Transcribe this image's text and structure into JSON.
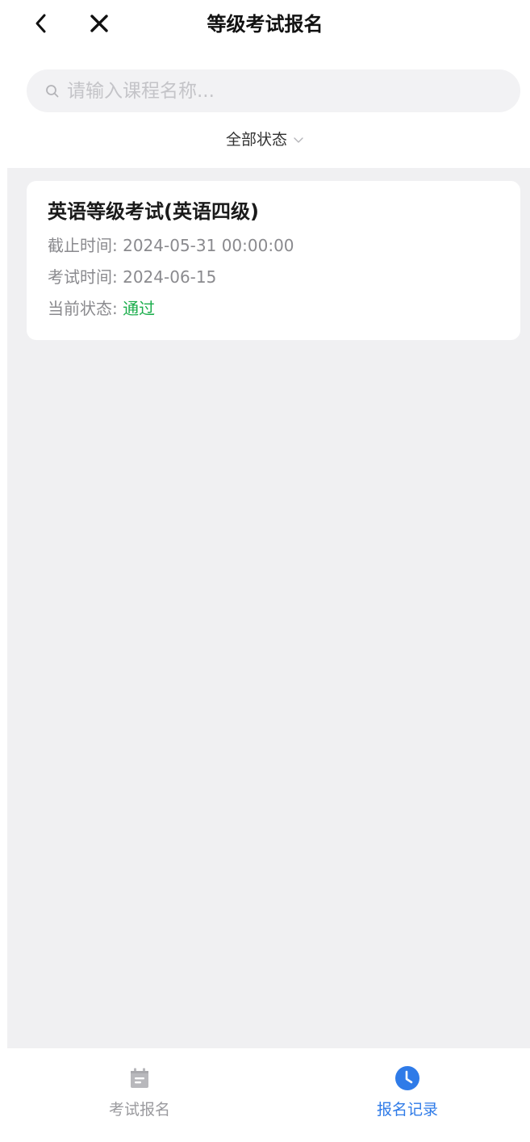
{
  "header": {
    "title": "等级考试报名",
    "back_icon": "chevron-left-icon",
    "close_icon": "close-icon"
  },
  "search": {
    "placeholder": "请输入课程名称...",
    "value": "",
    "icon": "search-icon"
  },
  "filter": {
    "label": "全部状态",
    "icon": "chevron-down-icon"
  },
  "records": [
    {
      "title": "英语等级考试(英语四级)",
      "deadline_label": "截止时间:",
      "deadline_value": "2024-05-31 00:00:00",
      "exam_time_label": "考试时间:",
      "exam_time_value": "2024-06-15",
      "status_label": "当前状态:",
      "status_value": "通过"
    }
  ],
  "tabbar": {
    "items": [
      {
        "label": "考试报名",
        "icon": "calendar-icon",
        "active": false
      },
      {
        "label": "报名记录",
        "icon": "clock-icon",
        "active": true
      }
    ]
  },
  "colors": {
    "accent": "#2f7be8",
    "status_pass": "#1aad4b",
    "background": "#f0f0f2",
    "muted_text": "#8a8a8e"
  }
}
